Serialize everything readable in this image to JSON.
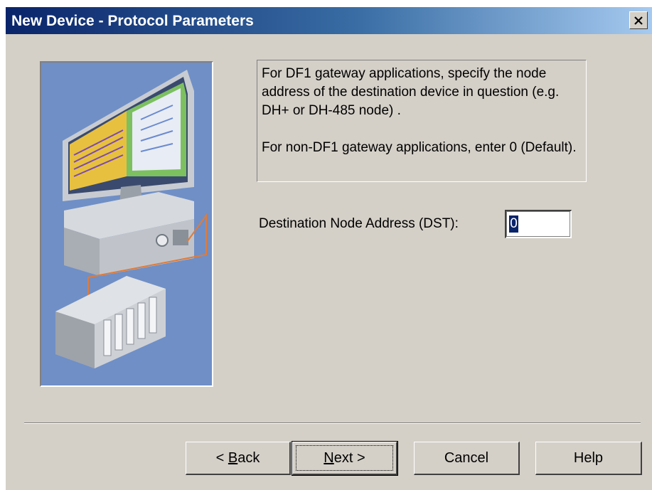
{
  "window": {
    "title": "New Device - Protocol Parameters",
    "close_symbol": "×"
  },
  "info": {
    "paragraph1": "For DF1 gateway applications, specify the node address of the destination device in question (e.g. DH+ or DH-485 node) .",
    "paragraph2": "For non-DF1 gateway applications, enter 0 (Default)."
  },
  "field": {
    "label": "Destination Node Address (DST):",
    "value": "0"
  },
  "buttons": {
    "back": {
      "prefix": "< ",
      "mnemonic": "B",
      "rest": "ack"
    },
    "next": {
      "mnemonic": "N",
      "rest": "ext",
      "suffix": " >"
    },
    "cancel": "Cancel",
    "help": "Help"
  },
  "colors": {
    "title_gradient_start": "#0a246a",
    "title_gradient_end": "#a6caf0",
    "dialog_bg": "#d4d0c8",
    "illustration_bg": "#6f8fc6",
    "cable": "#e07b39"
  },
  "icons": {
    "illustration": "computer-and-plc-icon",
    "close": "close-icon"
  }
}
